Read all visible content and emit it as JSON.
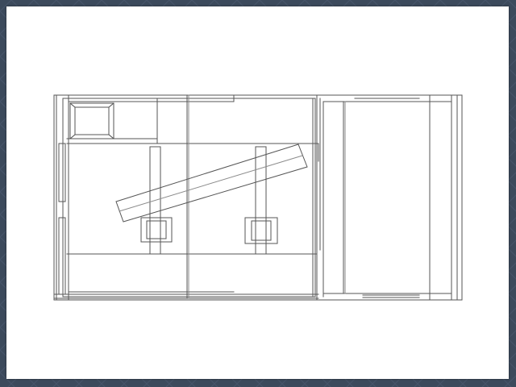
{
  "viewer": {
    "background_color": "#3c4a5c",
    "sheet_color": "#ffffff"
  },
  "drawing": {
    "line_color": "#555555",
    "light_line_color": "#8a8a8a",
    "accent_line_color": "#9a7060"
  }
}
